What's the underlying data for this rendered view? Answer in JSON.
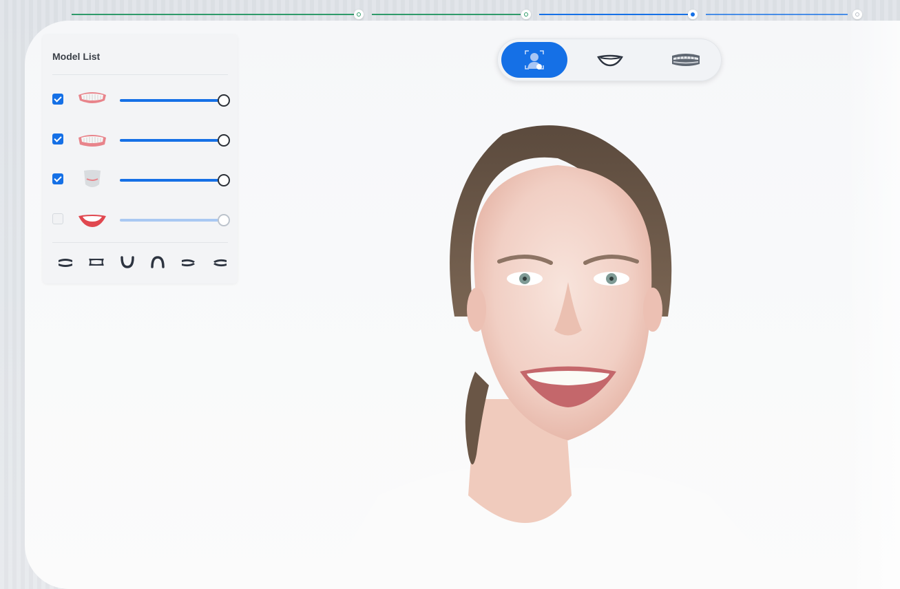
{
  "stepper": {
    "steps": [
      {
        "state": "done"
      },
      {
        "state": "done"
      },
      {
        "state": "active"
      },
      {
        "state": "todo"
      }
    ],
    "colors": {
      "done": "#2f9a6a",
      "active": "#1570e6",
      "todo": "#b8bec6"
    }
  },
  "model_list": {
    "title": "Model List",
    "items": [
      {
        "icon": "upper-jaw-model-icon",
        "checked": true,
        "opacity": 1.0
      },
      {
        "icon": "lower-jaw-model-icon",
        "checked": true,
        "opacity": 1.0
      },
      {
        "icon": "lower-jaw-base-model-icon",
        "checked": true,
        "opacity": 1.0
      },
      {
        "icon": "smile-lips-icon",
        "checked": false,
        "opacity": 1.0
      }
    ],
    "view_buttons": [
      "occlusal-view-icon",
      "front-view-icon",
      "lower-arch-view-icon",
      "upper-arch-view-icon",
      "left-view-icon",
      "right-view-icon"
    ]
  },
  "mode_switcher": {
    "options": [
      {
        "icon": "face-scan-icon",
        "active": true
      },
      {
        "icon": "smile-mouth-icon",
        "active": false
      },
      {
        "icon": "teeth-arch-icon",
        "active": false
      }
    ],
    "accent": "#1570e6"
  }
}
